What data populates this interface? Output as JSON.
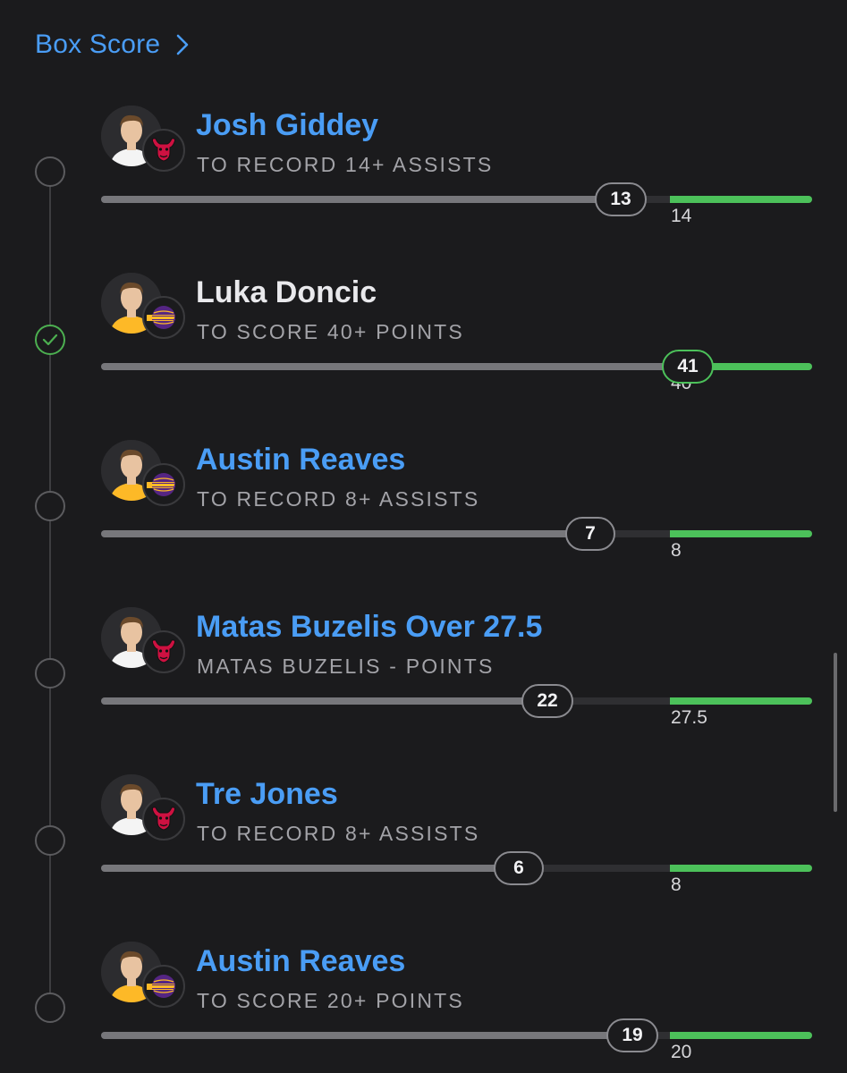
{
  "header": {
    "title": "Box Score",
    "chevron_icon": "chevron-right-icon"
  },
  "colors": {
    "link": "#4a9df5",
    "goal": "#4cc15a",
    "progress": "#77777b",
    "track": "#2f2f32",
    "background": "#1b1b1d"
  },
  "legs": [
    {
      "player": "Josh Giddey",
      "team": "Chicago Bulls",
      "team_icon": "bulls-logo",
      "prop": "TO RECORD 14+ ASSISTS",
      "current": "13",
      "target": "14",
      "progress": 0.93,
      "status": "pending",
      "highlight_name": true
    },
    {
      "player": "Luka Doncic",
      "team": "Los Angeles Lakers",
      "team_icon": "lakers-logo",
      "prop": "TO SCORE 40+ POINTS",
      "current": "41",
      "target": "40",
      "progress": 1.0,
      "status": "hit",
      "highlight_name": false
    },
    {
      "player": "Austin Reaves",
      "team": "Los Angeles Lakers",
      "team_icon": "lakers-logo",
      "prop": "TO RECORD 8+ ASSISTS",
      "current": "7",
      "target": "8",
      "progress": 0.875,
      "status": "pending",
      "highlight_name": true
    },
    {
      "player": "Matas Buzelis Over 27.5",
      "team": "Chicago Bulls",
      "team_icon": "bulls-logo",
      "prop": "MATAS BUZELIS - POINTS",
      "current": "22",
      "target": "27.5",
      "progress": 0.8,
      "status": "pending",
      "highlight_name": true
    },
    {
      "player": "Tre Jones",
      "team": "Chicago Bulls",
      "team_icon": "bulls-logo",
      "prop": "TO RECORD 8+ ASSISTS",
      "current": "6",
      "target": "8",
      "progress": 0.75,
      "status": "pending",
      "highlight_name": true
    },
    {
      "player": "Austin Reaves",
      "team": "Los Angeles Lakers",
      "team_icon": "lakers-logo",
      "prop": "TO SCORE 20+ POINTS",
      "current": "19",
      "target": "20",
      "progress": 0.95,
      "status": "pending",
      "highlight_name": true
    }
  ]
}
